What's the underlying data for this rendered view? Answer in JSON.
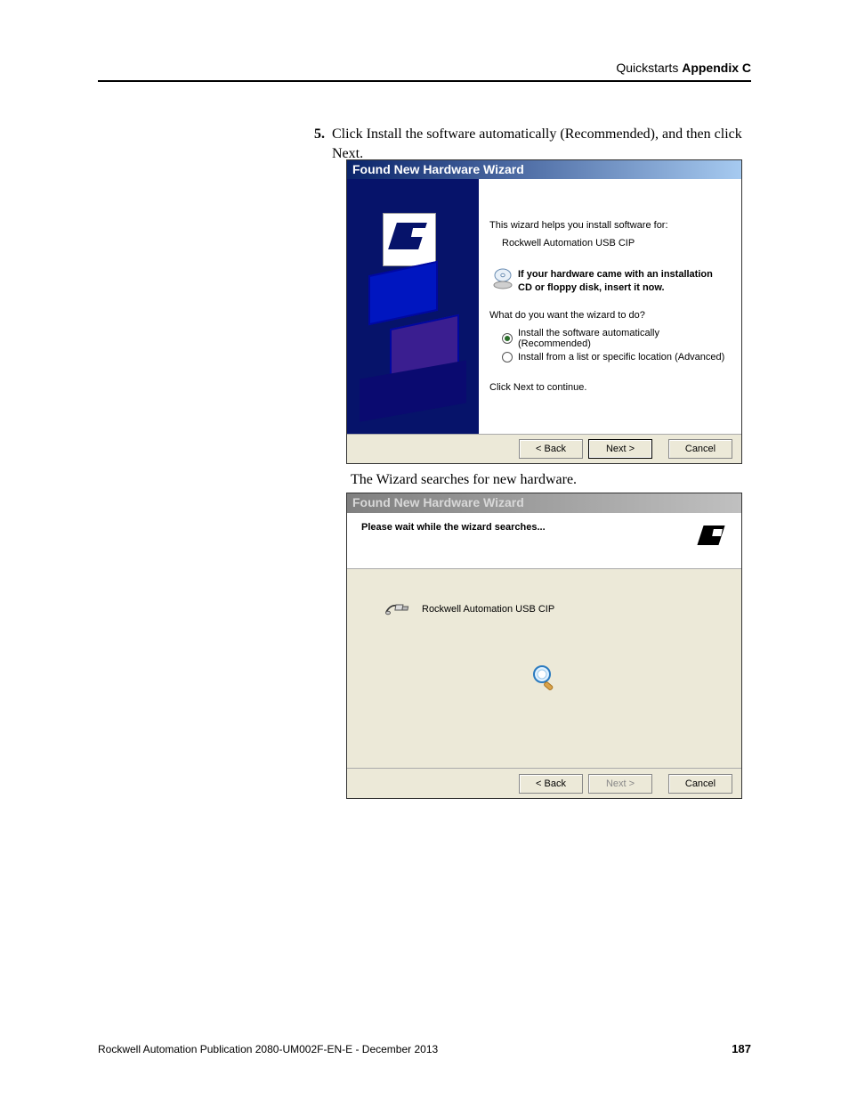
{
  "header": {
    "light": "Quickstarts ",
    "bold": "Appendix C"
  },
  "step": {
    "num": "5.",
    "text": "Click Install the software automatically (Recommended), and then click Next."
  },
  "caption2": "The Wizard searches for new hardware.",
  "dialog1": {
    "title": "Found New Hardware Wizard",
    "intro": "This wizard helps you install software for:",
    "device": "Rockwell Automation USB CIP",
    "cd_notice": "If your hardware came with an installation CD or floppy disk, insert it now.",
    "prompt": "What do you want the wizard to do?",
    "option_auto": "Install the software automatically (Recommended)",
    "option_list": "Install from a list or specific location (Advanced)",
    "continue": "Click Next to continue.",
    "buttons": {
      "back": "< Back",
      "next": "Next >",
      "cancel": "Cancel"
    }
  },
  "dialog2": {
    "title": "Found New Hardware Wizard",
    "header_text": "Please wait while the wizard searches...",
    "device": "Rockwell Automation USB CIP",
    "buttons": {
      "back": "< Back",
      "next": "Next >",
      "cancel": "Cancel"
    }
  },
  "footer": {
    "publication": "Rockwell Automation Publication 2080-UM002F-EN-E - December 2013",
    "page": "187"
  }
}
